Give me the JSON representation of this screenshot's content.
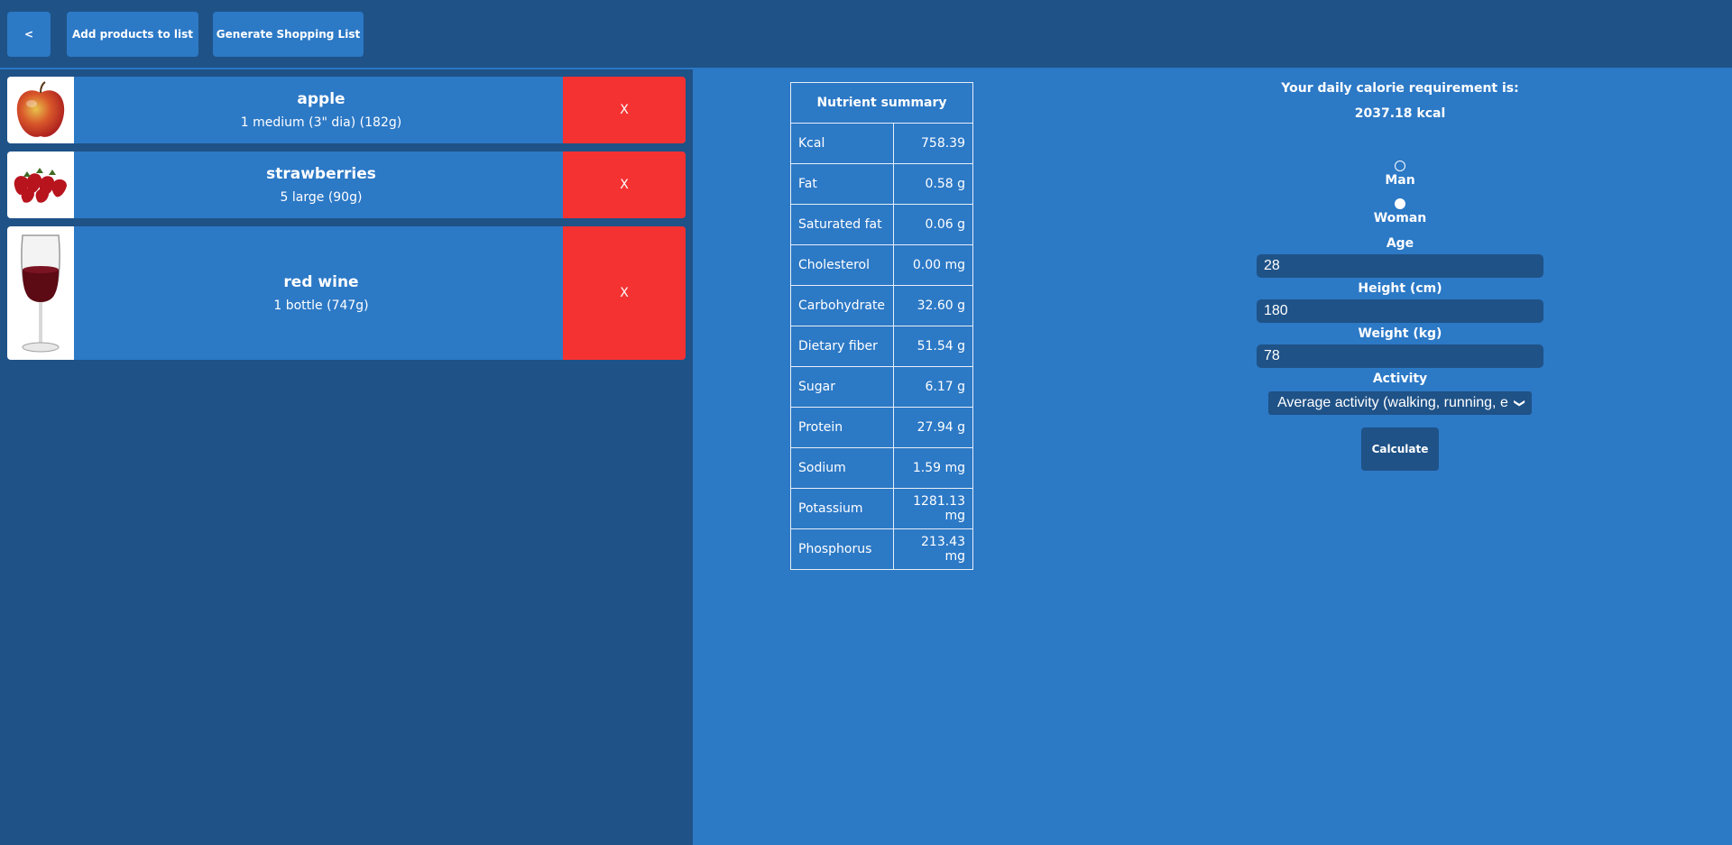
{
  "toolbar": {
    "back_label": "<",
    "add_products_label": "Add products to list",
    "generate_list_label": "Generate Shopping List"
  },
  "products": [
    {
      "name": "apple",
      "quantity": "1 medium (3\" dia) (182g)",
      "remove_label": "X",
      "image": "apple"
    },
    {
      "name": "strawberries",
      "quantity": "5 large (90g)",
      "remove_label": "X",
      "image": "strawberries"
    },
    {
      "name": "red wine",
      "quantity": "1 bottle (747g)",
      "remove_label": "X",
      "image": "red-wine-glass"
    }
  ],
  "nutrient_summary": {
    "title": "Nutrient summary",
    "rows": [
      {
        "label": "Kcal",
        "value": "758.39"
      },
      {
        "label": "Fat",
        "value": "0.58 g"
      },
      {
        "label": "Saturated fat",
        "value": "0.06 g"
      },
      {
        "label": "Cholesterol",
        "value": "0.00 mg"
      },
      {
        "label": "Carbohydrate",
        "value": "32.60 g"
      },
      {
        "label": "Dietary fiber",
        "value": "51.54 g"
      },
      {
        "label": "Sugar",
        "value": "6.17 g"
      },
      {
        "label": "Protein",
        "value": "27.94 g"
      },
      {
        "label": "Sodium",
        "value": "1.59 mg"
      },
      {
        "label": "Potassium",
        "value": "1281.13 mg"
      },
      {
        "label": "Phosphorus",
        "value": "213.43 mg"
      }
    ]
  },
  "calculator": {
    "requirement_label": "Your daily calorie requirement is:",
    "requirement_value": "2037.18 kcal",
    "gender_options": [
      {
        "label": "Man",
        "selected": false
      },
      {
        "label": "Woman",
        "selected": true
      }
    ],
    "age_label": "Age",
    "age_value": "28",
    "height_label": "Height (cm)",
    "height_value": "180",
    "weight_label": "Weight (kg)",
    "weight_value": "78",
    "activity_label": "Activity",
    "activity_value": "Average activity (walking, running, e",
    "calculate_label": "Calculate"
  },
  "colors": {
    "dark_blue": "#1f5287",
    "blue": "#2c79c6",
    "red": "#f53232"
  }
}
